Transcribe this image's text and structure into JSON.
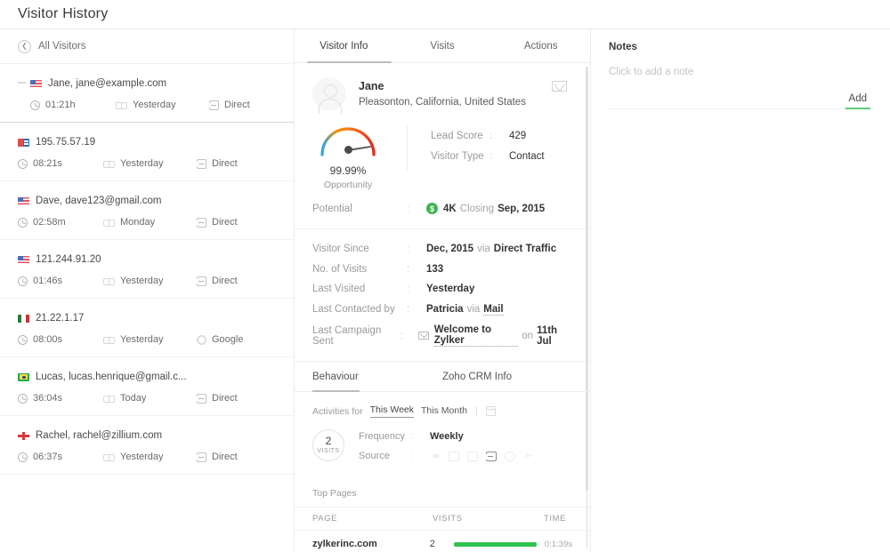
{
  "window": {
    "title": "Visitor History"
  },
  "sidebar": {
    "back_label": "All Visitors",
    "back_icon": "chevron-left-circle-icon",
    "visitors": [
      {
        "name": "Jane, jane@example.com",
        "flag": "us",
        "duration": "01:21h",
        "when": "Yesterday",
        "source": "Direct",
        "source_icon": "direct-icon",
        "selected": true
      },
      {
        "name": "195.75.57.19",
        "flag": "eu",
        "duration": "08:21s",
        "when": "Yesterday",
        "source": "Direct",
        "source_icon": "direct-icon",
        "selected": false
      },
      {
        "name": "Dave, dave123@gmail.com",
        "flag": "us",
        "duration": "02:58m",
        "when": "Monday",
        "source": "Direct",
        "source_icon": "direct-icon",
        "selected": false
      },
      {
        "name": "121.244.91.20",
        "flag": "us",
        "duration": "01:46s",
        "when": "Yesterday",
        "source": "Direct",
        "source_icon": "direct-icon",
        "selected": false
      },
      {
        "name": "21.22.1.17",
        "flag": "it",
        "duration": "08:00s",
        "when": "Yesterday",
        "source": "Google",
        "source_icon": "google-icon",
        "selected": false
      },
      {
        "name": "Lucas, lucas.henrique@gmail.c...",
        "flag": "br",
        "duration": "36:04s",
        "when": "Today",
        "source": "Direct",
        "source_icon": "direct-icon",
        "selected": false
      },
      {
        "name": "Rachel, rachel@zillium.com",
        "flag": "gb",
        "duration": "06:37s",
        "when": "Yesterday",
        "source": "Direct",
        "source_icon": "direct-icon",
        "selected": false
      }
    ]
  },
  "center": {
    "tabs": [
      {
        "label": "Visitor Info",
        "active": true
      },
      {
        "label": "Visits",
        "active": false
      },
      {
        "label": "Actions",
        "active": false
      }
    ],
    "profile": {
      "name": "Jane",
      "location": "Pleasonton, California, United States",
      "avatar_icon": "user-avatar-icon",
      "mail_icon": "envelope-icon"
    },
    "gauge": {
      "percent": "99.99%",
      "label": "Opportunity",
      "colors": {
        "low": "#29a7e0",
        "mid": "#f59000",
        "high": "#e8231a"
      }
    },
    "score_rows": [
      {
        "key": "Lead Score",
        "sep": ":",
        "value": "429"
      },
      {
        "key": "Visitor Type",
        "sep": ":",
        "value": "Contact"
      }
    ],
    "potential": {
      "key": "Potential",
      "sep": ":",
      "badge": "$",
      "badge_color": "#3fb34f",
      "amount": "4K",
      "closing_label": "Closing",
      "closing_date": "Sep, 2015"
    },
    "details": [
      {
        "key": "Visitor Since",
        "sep": ":",
        "value": "Dec, 2015",
        "via": "via",
        "extra": "Direct Traffic",
        "icon": null,
        "underline": false
      },
      {
        "key": "No. of Visits",
        "sep": ":",
        "value": "133",
        "via": "",
        "extra": "",
        "icon": null,
        "underline": false
      },
      {
        "key": "Last Visited",
        "sep": ":",
        "value": "Yesterday",
        "via": "",
        "extra": "",
        "icon": null,
        "underline": false
      },
      {
        "key": "Last Contacted by",
        "sep": ":",
        "value": "Patricia",
        "via": "via",
        "extra": "Mail",
        "icon": null,
        "underline": true
      },
      {
        "key": "Last Campaign Sent",
        "sep": ":",
        "value": "Welcome to Zylker",
        "via": "on",
        "extra": "11th Jul",
        "icon": "mail-icon",
        "underline": true
      }
    ],
    "sub_tabs": [
      {
        "label": "Behaviour",
        "active": true
      },
      {
        "label": "Zoho CRM Info",
        "active": false
      }
    ],
    "activities": {
      "label": "Activities for",
      "options": [
        {
          "label": "This Week",
          "selected": true
        },
        {
          "label": "This Month",
          "selected": false
        }
      ],
      "calendar_icon": "calendar-icon"
    },
    "visits_circle": {
      "count": "2",
      "label": "VISITS"
    },
    "behaviour_rows": [
      {
        "key": "Frequency",
        "sep": ":",
        "value": "Weekly"
      },
      {
        "key": "Source",
        "sep": ":",
        "value": ""
      }
    ],
    "source_icons": [
      {
        "name": "ad-icon",
        "active": false
      },
      {
        "name": "display-icon",
        "active": false
      },
      {
        "name": "email-icon",
        "active": false
      },
      {
        "name": "direct-traffic-icon",
        "active": true
      },
      {
        "name": "search-icon",
        "active": false
      },
      {
        "name": "social-icon",
        "active": false
      }
    ],
    "top_pages": {
      "section_label": "Top Pages",
      "columns": [
        "PAGE",
        "VISITS",
        "TIME"
      ],
      "rows": [
        {
          "page": "zylkerinc.com",
          "visits": "2",
          "time": "0:1:39s",
          "bar_color": "#2ec24f",
          "bar_pct": 100
        }
      ]
    }
  },
  "notes": {
    "title": "Notes",
    "placeholder": "Click to add a note",
    "add_label": "Add",
    "accent": "#5fc977"
  }
}
